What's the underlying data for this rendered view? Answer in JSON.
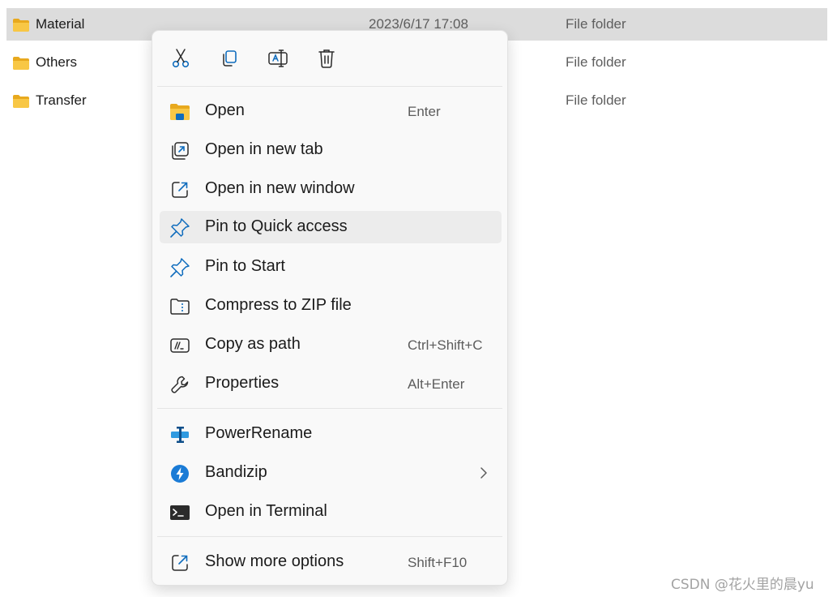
{
  "files": [
    {
      "name": "Material",
      "date": "2023/6/17 17:08",
      "type": "File folder",
      "selected": true
    },
    {
      "name": "Others",
      "date": "",
      "type": "File folder",
      "selected": false
    },
    {
      "name": "Transfer",
      "date": "",
      "type": "File folder",
      "selected": false
    }
  ],
  "quick_actions": [
    {
      "icon": "cut-icon"
    },
    {
      "icon": "copy-icon"
    },
    {
      "icon": "rename-icon"
    },
    {
      "icon": "delete-icon"
    }
  ],
  "menu": {
    "items": [
      {
        "label": "Open",
        "shortcut": "Enter",
        "icon": "folder-open-icon"
      },
      {
        "label": "Open in new tab",
        "shortcut": "",
        "icon": "new-tab-icon"
      },
      {
        "label": "Open in new window",
        "shortcut": "",
        "icon": "new-window-icon"
      },
      {
        "label": "Pin to Quick access",
        "shortcut": "",
        "icon": "pin-icon",
        "highlighted": true
      },
      {
        "label": "Pin to Start",
        "shortcut": "",
        "icon": "pin-icon"
      },
      {
        "label": "Compress to ZIP file",
        "shortcut": "",
        "icon": "zip-icon"
      },
      {
        "label": "Copy as path",
        "shortcut": "Ctrl+Shift+C",
        "icon": "copy-path-icon"
      },
      {
        "label": "Properties",
        "shortcut": "Alt+Enter",
        "icon": "wrench-icon"
      }
    ],
    "extensions": [
      {
        "label": "PowerRename",
        "icon": "powerrename-icon"
      },
      {
        "label": "Bandizip",
        "icon": "bandizip-icon",
        "has_submenu": true
      },
      {
        "label": "Open in Terminal",
        "icon": "terminal-icon"
      }
    ],
    "more": {
      "label": "Show more options",
      "shortcut": "Shift+F10",
      "icon": "show-more-icon"
    }
  },
  "colors": {
    "accent": "#0f6cbd",
    "selection": "#dcdcdc",
    "hover": "#ececec",
    "folder": "#f4c542"
  },
  "watermark": "CSDN @花火里的晨yu"
}
